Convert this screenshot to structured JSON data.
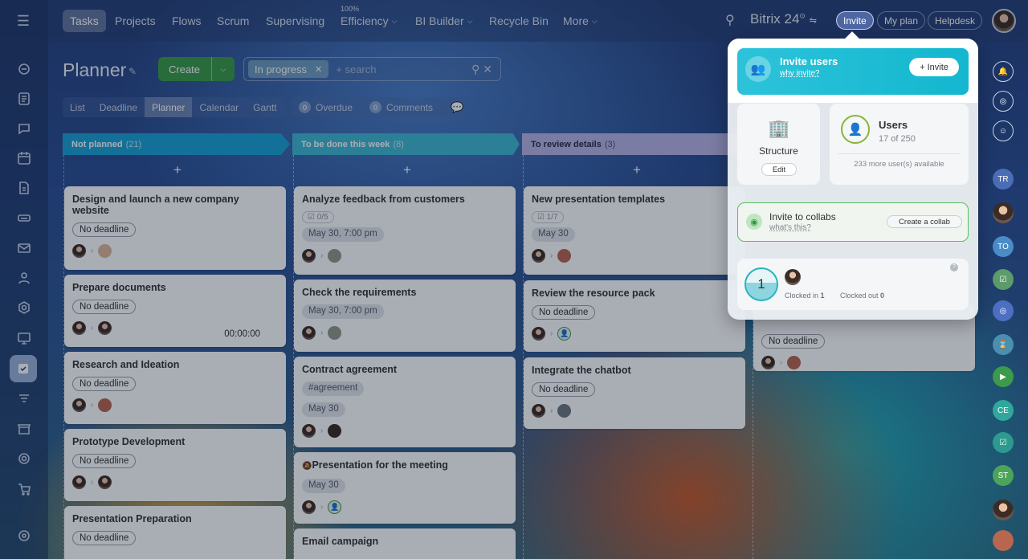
{
  "topnav": {
    "items": [
      {
        "label": "Tasks"
      },
      {
        "label": "Projects"
      },
      {
        "label": "Flows"
      },
      {
        "label": "Scrum"
      },
      {
        "label": "Supervising"
      },
      {
        "label": "Efficiency",
        "sup": "100%"
      },
      {
        "label": "BI Builder"
      },
      {
        "label": "Recycle Bin"
      },
      {
        "label": "More"
      }
    ],
    "brand": "Bitrix 24",
    "invite": "Invite",
    "myplan": "My plan",
    "helpdesk": "Helpdesk"
  },
  "planner": {
    "title": "Planner",
    "create": "Create",
    "filter_chip": "In progress",
    "search_placeholder": "+ search",
    "views": [
      "List",
      "Deadline",
      "Planner",
      "Calendar",
      "Gantt"
    ],
    "overdue_count": "0",
    "overdue_label": "Overdue",
    "comments_count": "0",
    "comments_label": "Comments"
  },
  "columns": [
    {
      "title": "Not planned",
      "count": "(21)",
      "color": "#1aa4d6",
      "cards": [
        {
          "title": "Design and launch a new company website",
          "tag": "No deadline",
          "tag_style": "outline"
        },
        {
          "title": "Prepare documents",
          "tag": "No deadline",
          "tag_style": "outline",
          "timer": "00:00:00"
        },
        {
          "title": "Research and Ideation",
          "tag": "No deadline",
          "tag_style": "outline"
        },
        {
          "title": "Prototype Development",
          "tag": "No deadline",
          "tag_style": "outline"
        },
        {
          "title": "Presentation Preparation",
          "tag": "No deadline",
          "tag_style": "outline"
        }
      ]
    },
    {
      "title": "To be done this week",
      "count": "(8)",
      "color": "#3eb9d3",
      "cards": [
        {
          "title": "Analyze feedback from customers",
          "check": "0/5",
          "tag": "May 30, 7:00 pm",
          "tag_style": "fill"
        },
        {
          "title": "Check the requirements",
          "tag": "May 30, 7:00 pm",
          "tag_style": "fill"
        },
        {
          "title": "Contract agreement",
          "hashtag": "#agreement",
          "tag": "May 30",
          "tag_style": "fill"
        },
        {
          "title": "Presentation for the meeting",
          "tag": "May 30",
          "tag_style": "fill"
        },
        {
          "title": "Email campaign"
        }
      ]
    },
    {
      "title": "To review details",
      "count": "(3)",
      "color": "#b9b4e6",
      "cards": [
        {
          "title": "New presentation templates",
          "check": "1/7",
          "tag": "May 30",
          "tag_style": "fill"
        },
        {
          "title": "Review the resource pack",
          "tag": "No deadline",
          "tag_style": "outline"
        },
        {
          "title": "Integrate the chatbot",
          "tag": "No deadline",
          "tag_style": "outline"
        }
      ]
    },
    {
      "title": "",
      "count": "",
      "cards": [
        {
          "title": "",
          "tag": "No deadline",
          "tag_style": "outline"
        }
      ]
    }
  ],
  "popup": {
    "invite_title": "Invite users",
    "invite_sub": "why invite?",
    "invite_btn": "+ Invite",
    "structure": "Structure",
    "structure_btn": "Edit",
    "users_title": "Users",
    "users_count": "17 of 250",
    "users_more": "233 more user(s) available",
    "collab_title": "Invite to collabs",
    "collab_sub": "what's this?",
    "collab_btn": "Create a collab",
    "clock_number": "1",
    "clocked_in_label": "Clocked in",
    "clocked_in": "1",
    "clocked_out_label": "Clocked out",
    "clocked_out": "0"
  },
  "rightbar": {
    "initials": [
      "TR",
      "TO",
      "CE",
      "ST"
    ]
  }
}
